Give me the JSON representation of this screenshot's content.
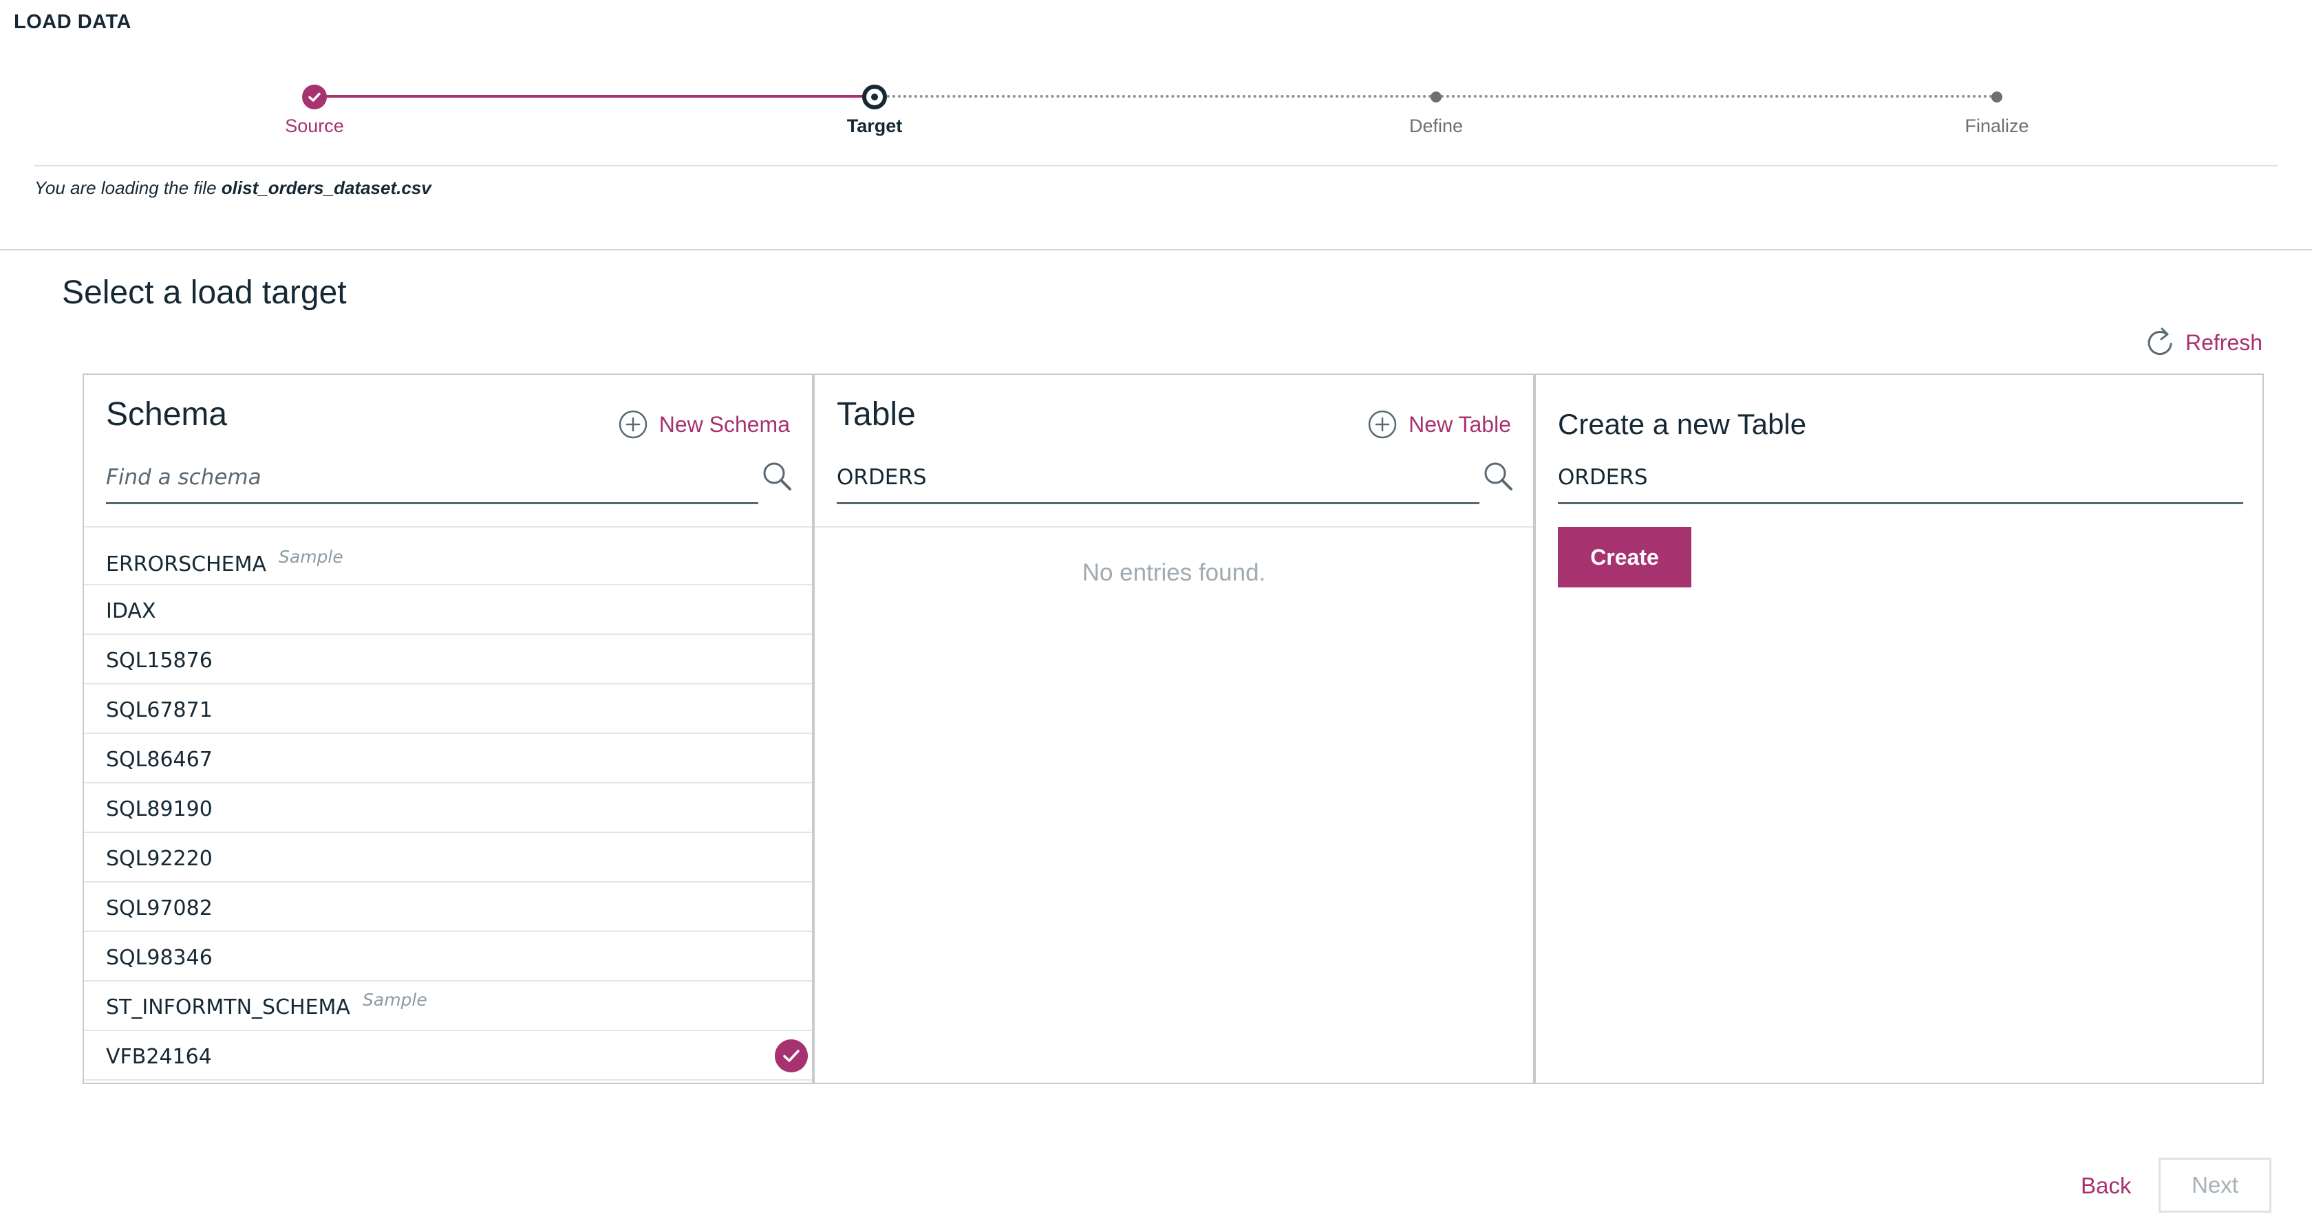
{
  "app": {
    "title": "LOAD DATA"
  },
  "stepper": {
    "steps": [
      {
        "label": "Source",
        "state": "complete"
      },
      {
        "label": "Target",
        "state": "current"
      },
      {
        "label": "Define",
        "state": "upcoming"
      },
      {
        "label": "Finalize",
        "state": "upcoming"
      }
    ]
  },
  "file_note": {
    "prefix": "You are loading the file",
    "filename": "olist_orders_dataset.csv"
  },
  "page": {
    "heading": "Select a load target",
    "refresh_label": "Refresh"
  },
  "schema_panel": {
    "title": "Schema",
    "new_label": "New Schema",
    "search_placeholder": "Find a schema",
    "search_value": "",
    "items": [
      {
        "name": "ERRORSCHEMA",
        "tag": "Sample",
        "selected": false
      },
      {
        "name": "IDAX",
        "tag": "",
        "selected": false
      },
      {
        "name": "SQL15876",
        "tag": "",
        "selected": false
      },
      {
        "name": "SQL67871",
        "tag": "",
        "selected": false
      },
      {
        "name": "SQL86467",
        "tag": "",
        "selected": false
      },
      {
        "name": "SQL89190",
        "tag": "",
        "selected": false
      },
      {
        "name": "SQL92220",
        "tag": "",
        "selected": false
      },
      {
        "name": "SQL97082",
        "tag": "",
        "selected": false
      },
      {
        "name": "SQL98346",
        "tag": "",
        "selected": false
      },
      {
        "name": "ST_INFORMTN_SCHEMA",
        "tag": "Sample",
        "selected": false
      },
      {
        "name": "VFB24164",
        "tag": "",
        "selected": true
      }
    ]
  },
  "table_panel": {
    "title": "Table",
    "new_label": "New Table",
    "search_value": "ORDERS",
    "empty_text": "No entries found."
  },
  "create_panel": {
    "title": "Create a new Table",
    "name_value": "ORDERS",
    "button_label": "Create"
  },
  "footer": {
    "back_label": "Back",
    "next_label": "Next"
  },
  "colors": {
    "accent": "#a6326f",
    "text": "#152935",
    "muted": "#6f6f6f",
    "disabled": "#a7b0b6"
  }
}
